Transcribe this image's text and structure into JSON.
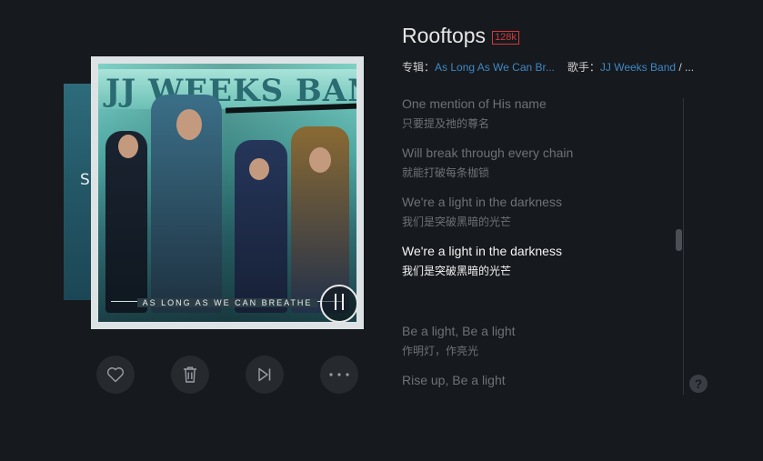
{
  "album_art": {
    "prev_cover_letter": "S",
    "band_name": "JJ WEEKS BAND",
    "subtitle": "AS LONG AS WE CAN BREATHE"
  },
  "song": {
    "title": "Rooftops",
    "quality_badge": "128k",
    "album_label": "专辑：",
    "album_name": "As Long As We Can Br...",
    "artist_label": "歌手：",
    "artist_name": "JJ Weeks Band",
    "artist_more": " / ..."
  },
  "lyrics": [
    {
      "en": "One mention of His name",
      "cn": "只要提及祂的尊名",
      "active": false
    },
    {
      "en": "Will break through every chain",
      "cn": "就能打破每条枷锁",
      "active": false
    },
    {
      "en": "We're a light in the darkness",
      "cn": "我们是突破黑暗的光芒",
      "active": false
    },
    {
      "en": "We're a light in the darkness",
      "cn": "我们是突破黑暗的光芒",
      "active": true
    },
    {
      "en": "Be a light, Be a light",
      "cn": "作明灯，作亮光",
      "active": false
    },
    {
      "en": "Rise up, Be a light",
      "cn": "",
      "active": false
    }
  ],
  "controls": {
    "icons": [
      "heart-icon",
      "trash-icon",
      "skip-next-icon",
      "more-icon"
    ]
  },
  "help": {
    "label": "?"
  },
  "colors": {
    "background": "#16191d",
    "link": "#3f88c5",
    "quality_badge": "#d13a3a",
    "lyric_inactive": "#6d7278",
    "lyric_active": "#f4f4f4"
  }
}
